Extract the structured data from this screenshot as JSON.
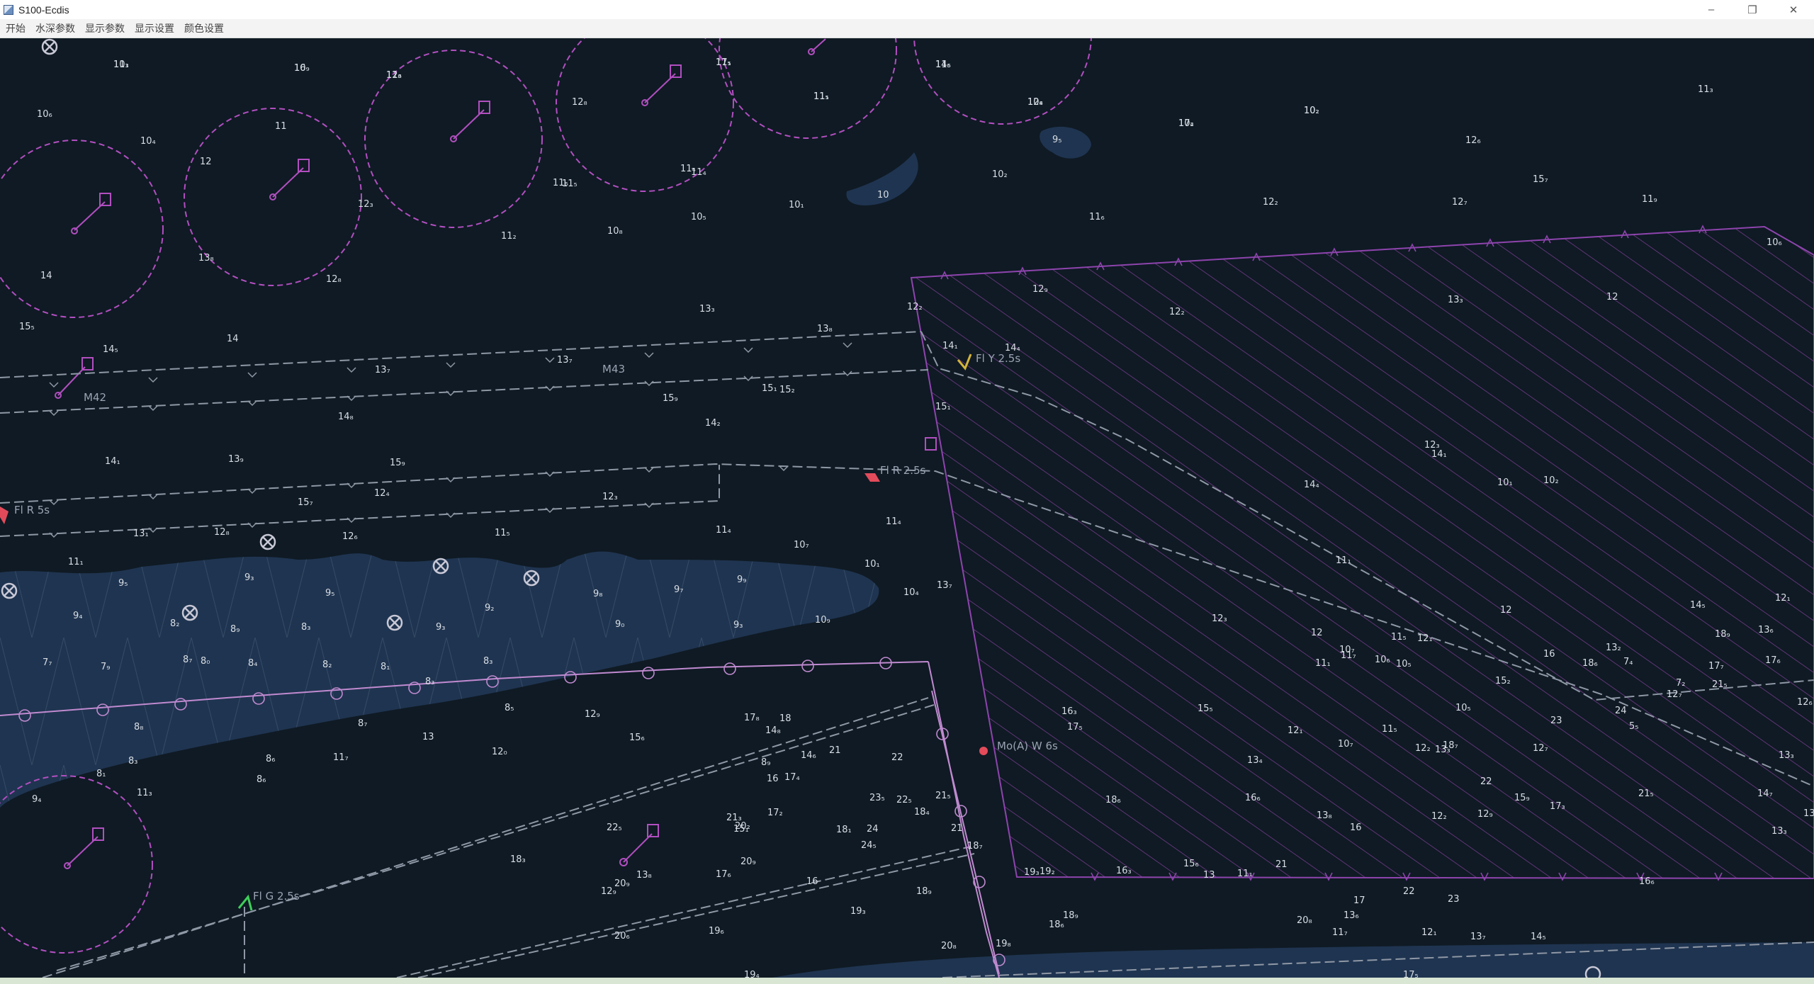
{
  "window": {
    "title": "S100-Ecdis"
  },
  "menu": [
    "开始",
    "水深参数",
    "显示参数",
    "显示设置",
    "颜色设置"
  ],
  "colors": {
    "deep_water": "#0f1a24",
    "shallow_water": "#1f3450",
    "restricted_area": "#8e44ad",
    "route_line": "#8f98a6",
    "anchorage_circle": "#b24fc0",
    "sounding_text": "#d9dee5"
  },
  "chart": {
    "light_labels": [
      "Fl Y 2.5s",
      "Fl R 2.5s",
      "Fl R 5s",
      "Mo(A) W 6s",
      "Fl G 2.5s"
    ],
    "buoy_labels": [
      "M43",
      "M42"
    ],
    "soundings": [
      "10₃",
      "10₉",
      "11₆",
      "11₅",
      "11₁",
      "11₆",
      "10₈",
      "10₂",
      "10₂",
      "11₃",
      "10₆",
      "10₄",
      "11",
      "12",
      "12₈",
      "11₄",
      "10₂",
      "12₆",
      "11₅",
      "11₄",
      "14",
      "12₃",
      "13₈",
      "12₈",
      "11₆",
      "10₅",
      "10₈",
      "11₂",
      "10₁",
      "10₂",
      "10",
      "9₅",
      "11₆",
      "12₂",
      "12₇",
      "11₉",
      "15₇",
      "12₉",
      "12₂",
      "13₃",
      "12",
      "10₆",
      "13₃",
      "12₂",
      "14₅",
      "14",
      "15₅",
      "13₇",
      "13₇",
      "13₈",
      "14₁",
      "14₄",
      "15₁",
      "15₉",
      "14₈",
      "14₂",
      "15₁",
      "15₂",
      "13₉",
      "14₁",
      "15₉",
      "15₇",
      "12₄",
      "12₃",
      "13₁",
      "12₈",
      "12₆",
      "11₅",
      "11₄",
      "10₇",
      "10₁",
      "10₄",
      "11₄",
      "13₇",
      "11₁",
      "9₅",
      "9₃",
      "9₅",
      "9₂",
      "9₈",
      "9₇",
      "9₉",
      "9₄",
      "8₂",
      "8₉",
      "8₃",
      "8₇",
      "9₃",
      "9₀",
      "9₃",
      "7₇",
      "7₉",
      "8₀",
      "8₁",
      "8₃",
      "8₄",
      "8₂",
      "8₃",
      "8₅",
      "8₆",
      "8₇",
      "8₈",
      "8₁",
      "8₃",
      "8₆",
      "8₉",
      "9₄",
      "11₃",
      "10₉",
      "12₉",
      "11₇",
      "13",
      "15₆",
      "16",
      "12₀",
      "17₈",
      "18",
      "14₈",
      "14₆",
      "21",
      "22",
      "22₅",
      "24₅",
      "24",
      "23₅",
      "21₅",
      "21",
      "20₉",
      "20₂",
      "21₃",
      "22₅",
      "20₉",
      "18₃",
      "17₆",
      "17₂",
      "17₄",
      "15₁",
      "13₈",
      "12₉",
      "16",
      "18₁",
      "18₄",
      "18₇",
      "18₉",
      "19₃",
      "20₆",
      "20₈",
      "19₆",
      "19₄",
      "19₈",
      "19₃",
      "19₂",
      "16₃",
      "15₆",
      "13",
      "11₁",
      "11₇",
      "13₆",
      "12₁",
      "13₇",
      "14₅",
      "17₅",
      "18₆",
      "18₉",
      "20₈",
      "21",
      "17",
      "22",
      "23",
      "21₅",
      "15₉",
      "16₆",
      "17₃",
      "16₆",
      "18₆",
      "17₅",
      "16₃",
      "15₅",
      "13₄",
      "12₁",
      "11₅",
      "10₅",
      "10₅",
      "11₇",
      "12₁",
      "15₂",
      "16",
      "18₆",
      "13₂",
      "12₇",
      "12₆",
      "13₃",
      "14₇",
      "13₁",
      "13₃",
      "12₂",
      "12₉",
      "12₇",
      "13₃",
      "12",
      "12",
      "10₁",
      "10₂",
      "12₃",
      "14₄",
      "14₁",
      "11₁",
      "12₃",
      "11₅",
      "10₇",
      "10₆",
      "10₇",
      "11₁",
      "12₂",
      "13₈",
      "16",
      "18₇",
      "22",
      "23",
      "24",
      "21₅",
      "17₇",
      "17₆",
      "18₉",
      "13₆",
      "12₁",
      "14₅",
      "5₅",
      "7₄",
      "7₂",
      "11₁",
      "16",
      "12₃",
      "17₁",
      "11₅",
      "14₅",
      "12₄",
      "17₄"
    ]
  }
}
